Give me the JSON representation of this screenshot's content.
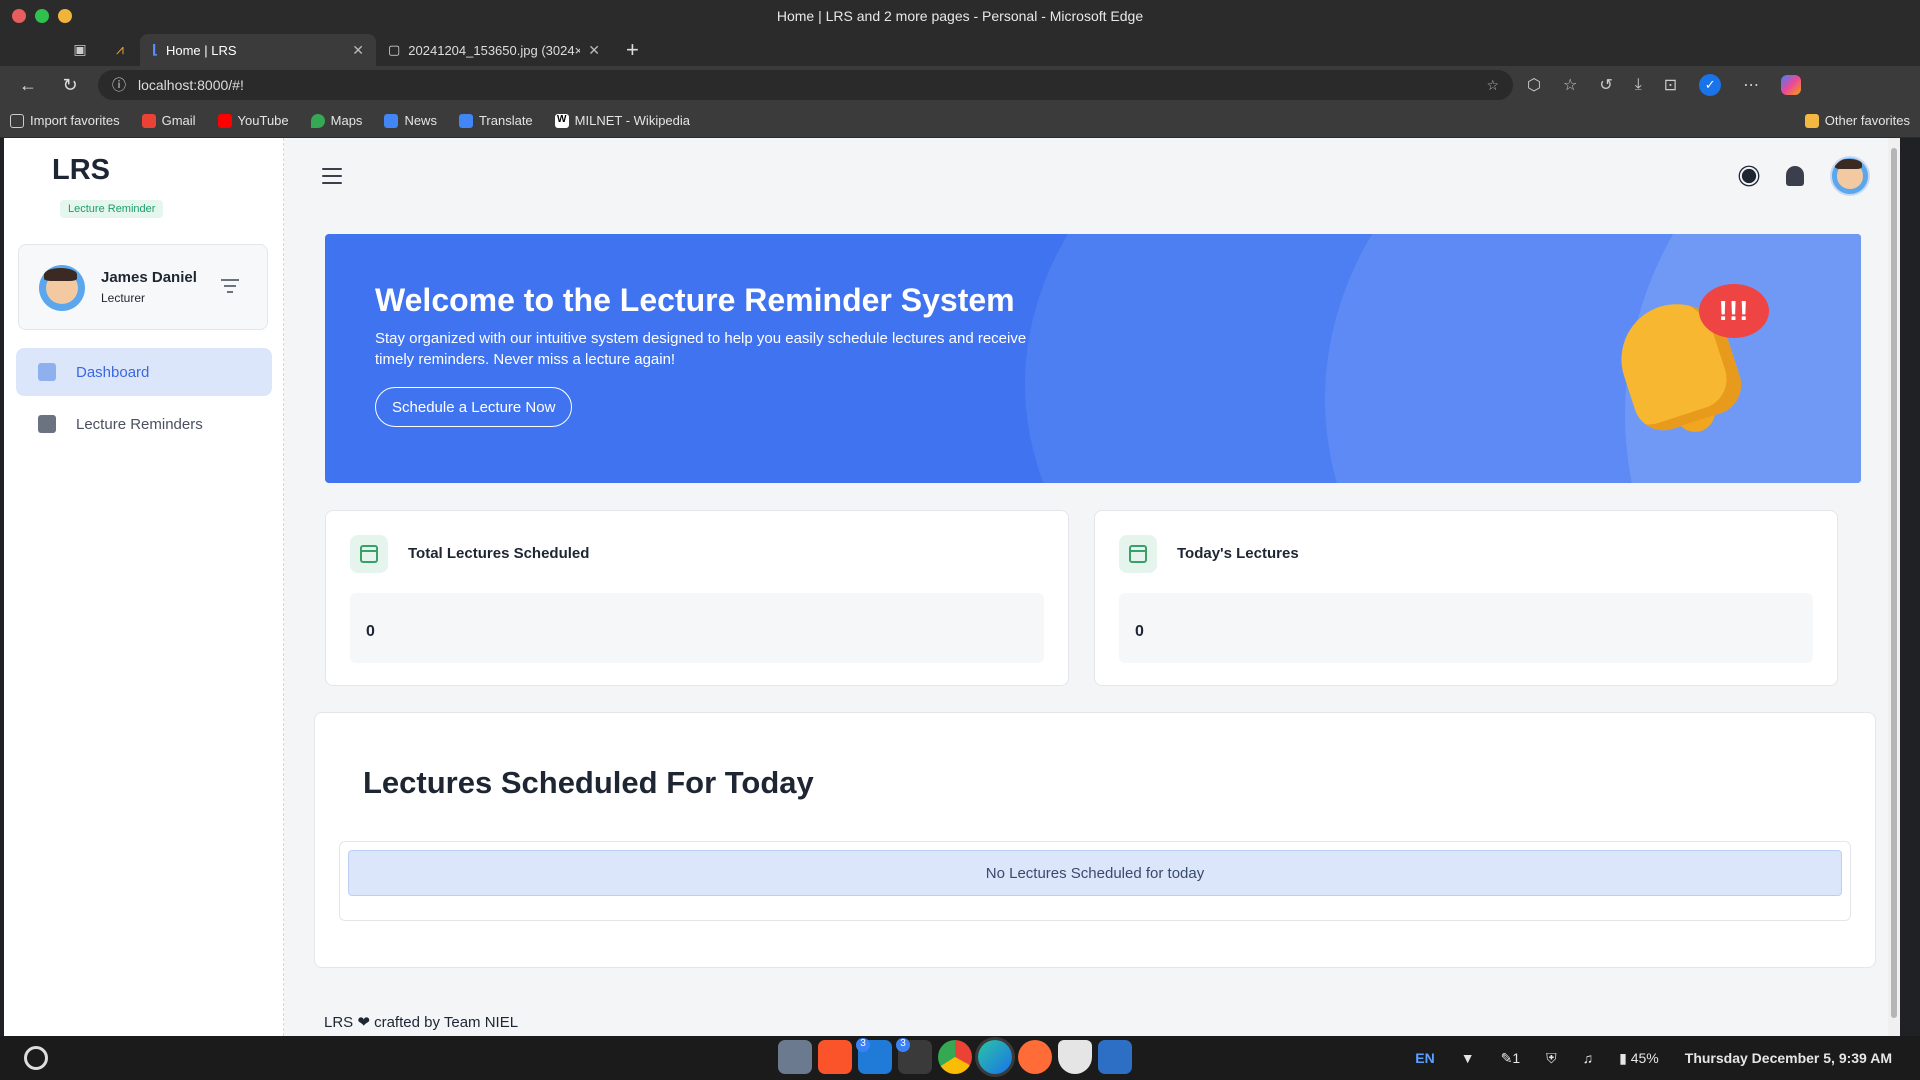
{
  "window": {
    "title": "Home | LRS and 2 more pages - Personal - Microsoft Edge",
    "traffic_colors": [
      "#e85d5d",
      "#2fc050",
      "#f0b43a"
    ]
  },
  "tabs": [
    {
      "label": "Home | LRS",
      "active": true
    },
    {
      "label": "20241204_153650.jpg (3024×",
      "active": false
    }
  ],
  "address_bar": {
    "url": "localhost:8000/#!"
  },
  "favorites": {
    "items": [
      "Import favorites",
      "Gmail",
      "YouTube",
      "Maps",
      "News",
      "Translate",
      "MILNET - Wikipedia"
    ],
    "other": "Other favorites"
  },
  "sidebar": {
    "brand": "LRS",
    "badge": "Lecture Reminder",
    "user": {
      "name": "James Daniel",
      "role": "Lecturer"
    },
    "nav": [
      {
        "label": "Dashboard",
        "active": true
      },
      {
        "label": "Lecture Reminders",
        "active": false
      }
    ]
  },
  "hero": {
    "title": "Welcome to the Lecture Reminder System",
    "text": "Stay organized with our intuitive system designed to help you easily schedule lectures and receive timely reminders. Never miss a lecture again!",
    "cta": "Schedule a Lecture Now",
    "bubble": "!!!"
  },
  "stats": [
    {
      "title": "Total Lectures Scheduled",
      "value": "0"
    },
    {
      "title": "Today's Lectures",
      "value": "0"
    }
  ],
  "today": {
    "heading": "Lectures Scheduled For Today",
    "empty_message": "No Lectures Scheduled for today"
  },
  "footer": "LRS ❤ crafted by Team NIEL",
  "taskbar": {
    "lang": "EN",
    "notifications": "1",
    "battery": "45%",
    "datetime": "Thursday December 5, 9:39 AM",
    "badges": [
      "3",
      "3"
    ]
  },
  "colors": {
    "accent": "#3f73f0",
    "success": "#38a169"
  }
}
